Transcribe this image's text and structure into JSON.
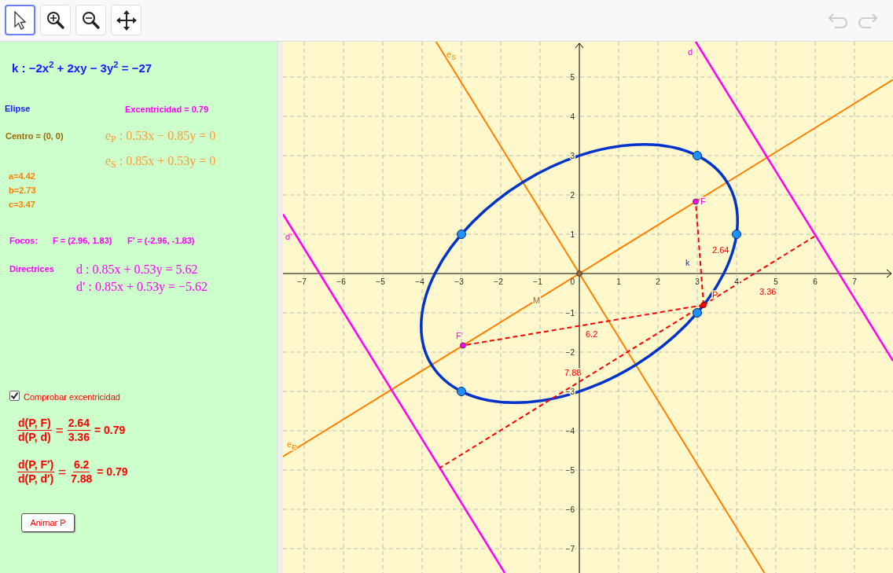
{
  "toolbar": {
    "tools": [
      {
        "kind": "select",
        "selected": true
      },
      {
        "kind": "zoom_in",
        "selected": false
      },
      {
        "kind": "zoom_out",
        "selected": false
      },
      {
        "kind": "move_view",
        "selected": false
      }
    ],
    "history": [
      {
        "kind": "undo",
        "disabled": true
      },
      {
        "kind": "redo",
        "disabled": true
      }
    ]
  },
  "algebra": {
    "equation": "k : −2x$^{2}$ + 2xy − 3y$^{2}$ = −27",
    "type": "Elipse",
    "eccentricity": "Excentricidad = 0.79",
    "center": "Centro = (0, 0)",
    "axis_equations": [
      "e$_{P}$ : 0.53x − 0.85y = 0",
      "e$_{S}$ : 0.85x + 0.53y = 0"
    ],
    "semi_axes": [
      "a=4.42",
      "b=2.73",
      "c=3.47"
    ],
    "foci_label": "Focos:",
    "foci": [
      "F = (2.96, 1.83)",
      "F' = (-2.96, -1.83)"
    ],
    "directrices_label": "Directrices",
    "directrices": [
      "d : 0.85x + 0.53y = 5.62",
      "d′ : 0.85x + 0.53y = −5.62"
    ],
    "check": {
      "label": "Comprobar excentricidad",
      "checked": true
    },
    "ratios": [
      {
        "num": "d(P, F)",
        "den": "d(P, d)",
        "eq": "=",
        "value_num": "2.64",
        "value_den": "3.36",
        "result": "= 0.79"
      },
      {
        "num": "d(P, F′)",
        "den": "d(P, d′)",
        "eq": "=",
        "value_num": "6.2",
        "value_den": "7.88",
        "result": "= 0.79"
      }
    ],
    "button": "Animar P"
  },
  "graphics": {
    "x_ticks": [
      "−7",
      "−6",
      "−5",
      "−4",
      "−3",
      "−2",
      "−1",
      "1",
      "2",
      "3",
      "4",
      "5",
      "6",
      "7"
    ],
    "y_ticks": [
      "5",
      "4",
      "3",
      "2",
      "1",
      "−1",
      "−2",
      "−3",
      "−4",
      "−5",
      "−6",
      "−7"
    ],
    "origin_label": "0",
    "labels": [
      {
        "kind": "minor_axis",
        "text": "e",
        "sub": "S"
      },
      {
        "kind": "directrix",
        "text": "d"
      },
      {
        "kind": "directrix_prime",
        "text": "d'"
      },
      {
        "kind": "major_axis",
        "text": "e",
        "sub": "P"
      },
      {
        "kind": "center",
        "text": "M"
      },
      {
        "kind": "conic",
        "text": "k"
      },
      {
        "kind": "focus",
        "text": "F"
      },
      {
        "kind": "focus_prime",
        "text": "F'"
      },
      {
        "kind": "point",
        "text": "P"
      },
      {
        "kind": "dist_pf",
        "text": "2.64"
      },
      {
        "kind": "dist_pd",
        "text": "3.36"
      },
      {
        "kind": "dist_pf2",
        "text": "6.2"
      },
      {
        "kind": "dist_pd2",
        "text": "7.88"
      }
    ]
  }
}
